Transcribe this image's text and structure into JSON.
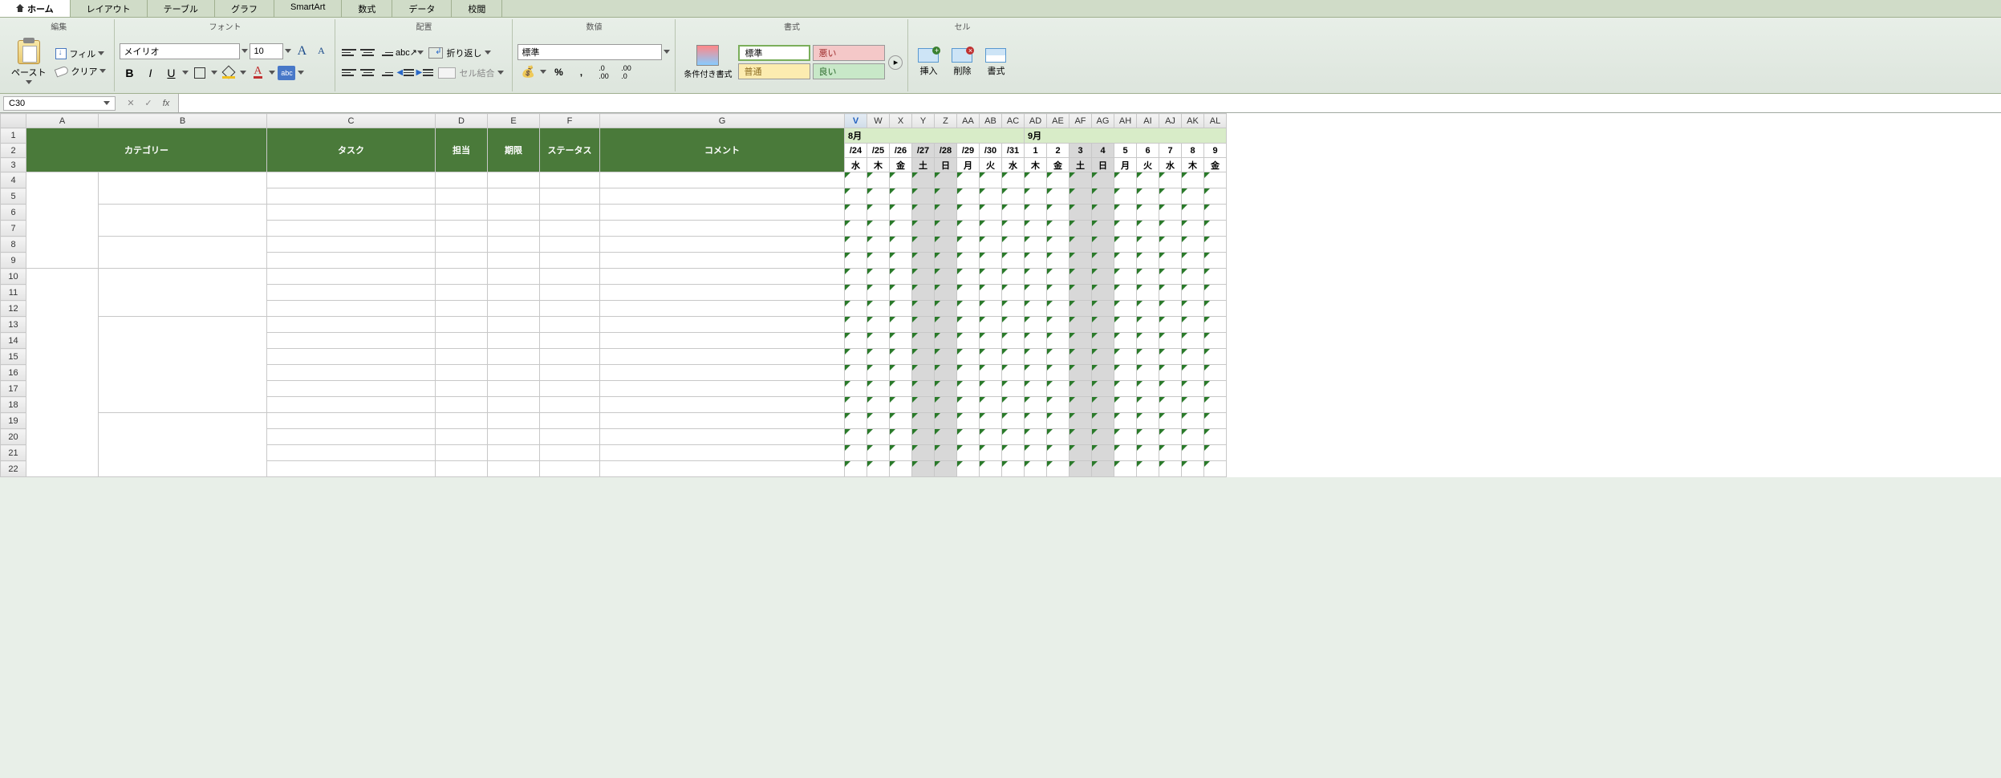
{
  "tabs": [
    "ホーム",
    "レイアウト",
    "テーブル",
    "グラフ",
    "SmartArt",
    "数式",
    "データ",
    "校閲"
  ],
  "active_tab": 0,
  "groups": {
    "edit": "編集",
    "font": "フォント",
    "align": "配置",
    "number": "数値",
    "format": "書式",
    "cell": "セル"
  },
  "paste_label": "ペースト",
  "fill_label": "フィル",
  "clear_label": "クリア",
  "font_name": "メイリオ",
  "font_size": "10",
  "wrap_label": "折り返し",
  "merge_label": "セル結合",
  "number_format": "標準",
  "cond_format_label": "条件付き書式",
  "styles": {
    "normal": "標準",
    "bad": "悪い",
    "neutral": "普通",
    "good": "良い"
  },
  "insert_label": "挿入",
  "delete_label": "削除",
  "format_label": "書式",
  "name_box": "C30",
  "columns": [
    "A",
    "B",
    "C",
    "D",
    "E",
    "F",
    "G",
    "V",
    "W",
    "X",
    "Y",
    "Z",
    "AA",
    "AB",
    "AC",
    "AD",
    "AE",
    "AF",
    "AG",
    "AH",
    "AI",
    "AJ",
    "AK",
    "AL"
  ],
  "selected_col": "V",
  "headers": {
    "category": "カテゴリー",
    "task": "タスク",
    "owner": "担当",
    "deadline": "期限",
    "status": "ステータス",
    "comment": "コメント",
    "month_aug": "8月",
    "month_sep": "9月"
  },
  "dates": [
    "/24",
    "/25",
    "/26",
    "/27",
    "/28",
    "/29",
    "/30",
    "/31",
    "1",
    "2",
    "3",
    "4",
    "5",
    "6",
    "7",
    "8",
    "9"
  ],
  "dows": [
    "水",
    "木",
    "金",
    "土",
    "日",
    "月",
    "火",
    "水",
    "木",
    "金",
    "土",
    "日",
    "月",
    "火",
    "水",
    "木",
    "金"
  ],
  "weekend_idx": [
    3,
    4,
    10,
    11
  ],
  "row_count": 19,
  "category_blocks": [
    {
      "a_start": 4,
      "a_end": 9,
      "b_splits": [
        4,
        6,
        8
      ]
    },
    {
      "a_start": 10,
      "a_end": 22,
      "b_splits": [
        10,
        13,
        19
      ]
    }
  ]
}
